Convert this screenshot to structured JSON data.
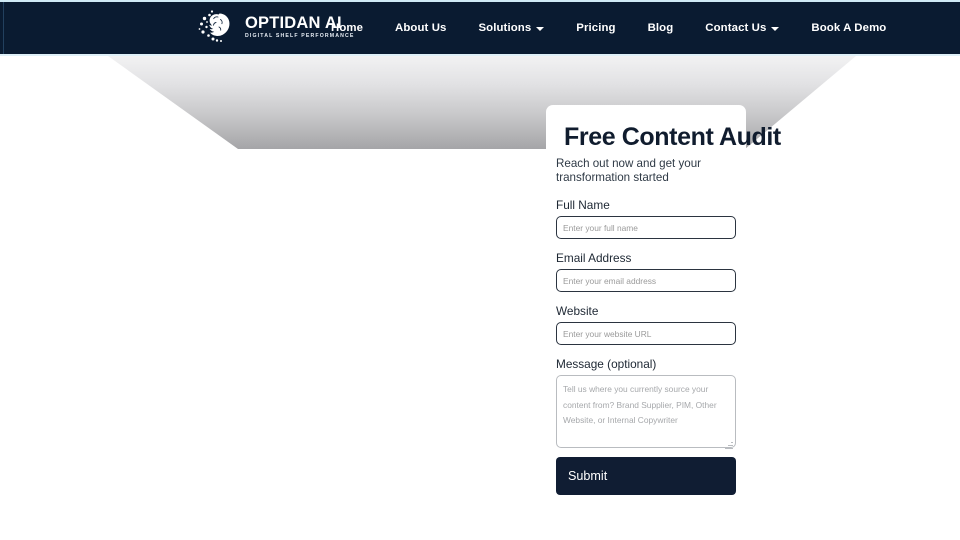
{
  "site": {
    "brand_name": "OPTIDAN AI",
    "brand_tagline": "DIGITAL SHELF PERFORMANCE",
    "logo_icon": "brain-network-icon",
    "nav_background": "#0a1b31",
    "accent_line": "#cfeaf5"
  },
  "nav": {
    "items": [
      {
        "label": "Home",
        "has_dropdown": false
      },
      {
        "label": "About Us",
        "has_dropdown": false
      },
      {
        "label": "Solutions",
        "has_dropdown": true
      },
      {
        "label": "Pricing",
        "has_dropdown": false
      },
      {
        "label": "Blog",
        "has_dropdown": false
      },
      {
        "label": "Contact Us",
        "has_dropdown": true
      },
      {
        "label": "Book A Demo",
        "has_dropdown": false
      }
    ]
  },
  "hero": {
    "shape": "angled-grey-banner",
    "gradient_from": "#f2f2f3",
    "gradient_to": "#a5a5a8"
  },
  "form": {
    "title": "Free Content Audit",
    "subtitle": "Reach out now and get your transformation started",
    "fields": [
      {
        "label": "Full Name",
        "placeholder": "Enter your full name",
        "value": "",
        "type": "text"
      },
      {
        "label": "Email Address",
        "placeholder": "Enter your email address",
        "value": "",
        "type": "email"
      },
      {
        "label": "Website",
        "placeholder": "Enter your website URL",
        "value": "",
        "type": "url"
      }
    ],
    "message": {
      "label": "Message (optional)",
      "placeholder": "Tell us where you currently source your content from? Brand Supplier, PIM, Other Website, or Internal Copywriter",
      "value": ""
    },
    "submit_label": "Submit",
    "submit_color": "#101d33"
  }
}
